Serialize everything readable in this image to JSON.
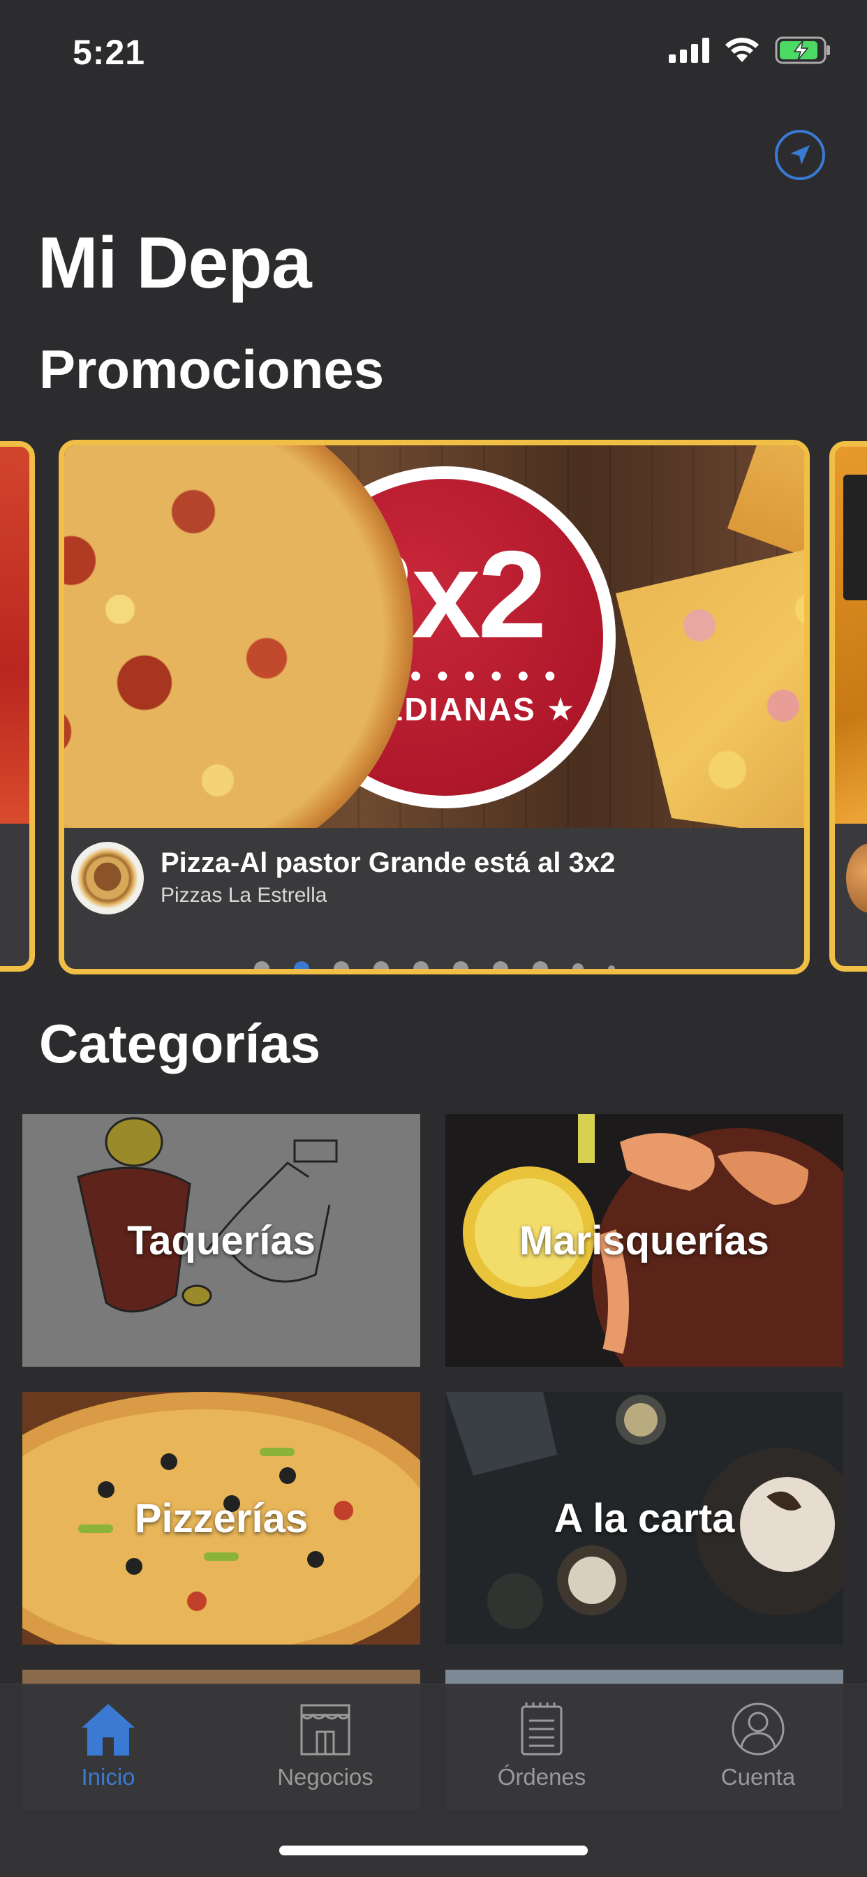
{
  "status_bar": {
    "time": "5:21"
  },
  "header": {
    "location_title": "Mi Depa",
    "locate_icon": "location-arrow-icon"
  },
  "promotions": {
    "title": "Promociones",
    "card": {
      "badge_big": "3x2",
      "badge_sub": "★ MEDIANAS ★",
      "tag": "3x2",
      "name": "Pizza-Al pastor Grande está al 3x2",
      "business": "Pizzas La Estrella"
    },
    "page_count": 10,
    "active_page": 1
  },
  "categories": {
    "title": "Categorías",
    "items": [
      {
        "label": "Taquerías"
      },
      {
        "label": "Marisquerías"
      },
      {
        "label": "Pizzerías"
      },
      {
        "label": "A la carta"
      }
    ]
  },
  "tab_bar": {
    "tabs": [
      {
        "label": "Inicio",
        "icon": "home-icon",
        "active": true
      },
      {
        "label": "Negocios",
        "icon": "storefront-icon",
        "active": false
      },
      {
        "label": "Órdenes",
        "icon": "receipt-icon",
        "active": false
      },
      {
        "label": "Cuenta",
        "icon": "account-icon",
        "active": false
      }
    ]
  },
  "colors": {
    "background": "#2c2c2e",
    "accent": "#3a7ad3",
    "card_border": "#f1bf45"
  }
}
